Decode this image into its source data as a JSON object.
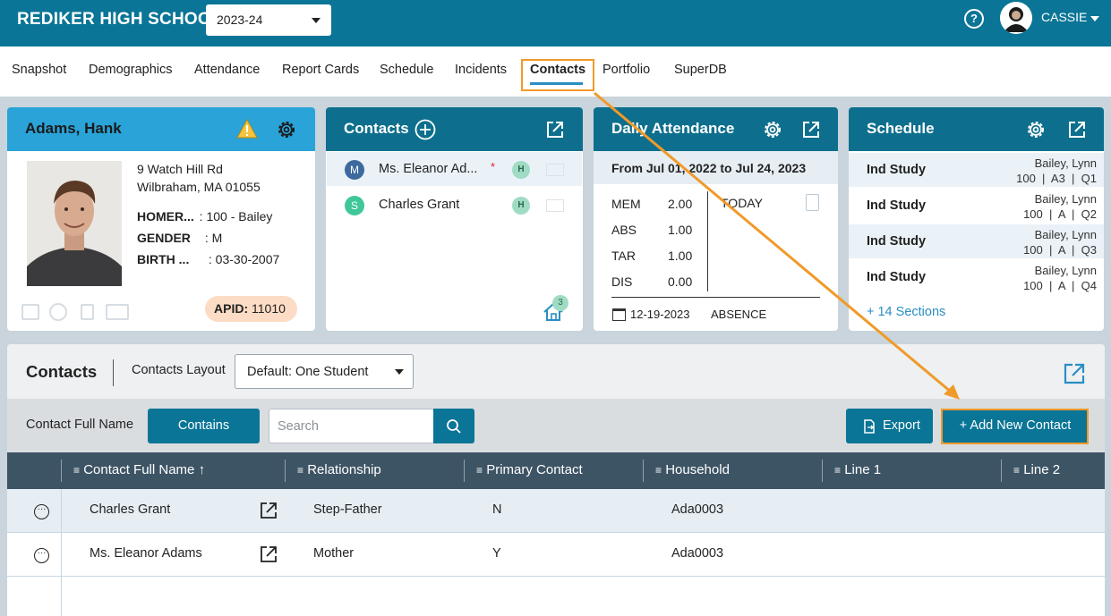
{
  "header": {
    "school_name": "REDIKER HIGH SCHOOL",
    "school_year": "2023-24",
    "user_name": "CASSIE",
    "help_glyph": "?"
  },
  "tabs": [
    {
      "label": "Snapshot"
    },
    {
      "label": "Demographics"
    },
    {
      "label": "Attendance"
    },
    {
      "label": "Report Cards"
    },
    {
      "label": "Schedule"
    },
    {
      "label": "Incidents"
    },
    {
      "label": "Contacts",
      "active": true
    },
    {
      "label": "Portfolio"
    },
    {
      "label": "SuperDB"
    }
  ],
  "student_card": {
    "name": "Adams, Hank",
    "address_line1": "9 Watch Hill Rd",
    "address_line2": "Wilbraham, MA 01055",
    "fields": [
      {
        "label": "HOMER...",
        "value": ": 100 - Bailey"
      },
      {
        "label": "GENDER",
        "value": ": M"
      },
      {
        "label": "BIRTH ...",
        "value": ": 03-30-2007"
      }
    ],
    "apid_label": "APID:",
    "apid_value": "11010"
  },
  "contacts_card": {
    "title": "Contacts",
    "contacts": [
      {
        "initial": "M",
        "name": "Ms. Eleanor Ad...",
        "required_mark": "*",
        "badge": "H",
        "avatar_color": "#3d6a9e"
      },
      {
        "initial": "S",
        "name": "Charles Grant",
        "badge": "H",
        "avatar_color": "#3fc79a"
      }
    ],
    "household_count": "3"
  },
  "attendance_card": {
    "title": "Daily Attendance",
    "range": "From Jul 01, 2022 to Jul 24, 2023",
    "stats": [
      {
        "label": "MEM",
        "value": "2.00"
      },
      {
        "label": "ABS",
        "value": "1.00"
      },
      {
        "label": "TAR",
        "value": "1.00"
      },
      {
        "label": "DIS",
        "value": "0.00"
      }
    ],
    "today_label": "TODAY",
    "last_date": "12-19-2023",
    "last_status": "ABSENCE"
  },
  "schedule_card": {
    "title": "Schedule",
    "rows": [
      {
        "course": "Ind Study",
        "teacher": "Bailey, Lynn",
        "detail": "100  |  A3  |  Q1"
      },
      {
        "course": "Ind Study",
        "teacher": "Bailey, Lynn",
        "detail": "100  |  A  |  Q2"
      },
      {
        "course": "Ind Study",
        "teacher": "Bailey, Lynn",
        "detail": "100  |  A  |  Q3"
      },
      {
        "course": "Ind Study",
        "teacher": "Bailey, Lynn",
        "detail": "100  |  A  |  Q4"
      }
    ],
    "more_link": "+ 14 Sections"
  },
  "contacts_panel": {
    "title": "Contacts",
    "layout_label": "Contacts Layout",
    "layout_value": "Default: One Student",
    "filter_field": "Contact Full Name",
    "filter_op": "Contains",
    "search_placeholder": "Search",
    "export_label": "Export",
    "add_label": "+ Add New Contact",
    "columns": [
      "Contact Full Name ↑",
      "Relationship",
      "Primary Contact",
      "Household",
      "Line 1",
      "Line 2"
    ],
    "rows": [
      {
        "name": "Charles Grant",
        "relationship": "Step-Father",
        "primary": "N",
        "household": "Ada0003"
      },
      {
        "name": "Ms. Eleanor Adams",
        "relationship": "Mother",
        "primary": "Y",
        "household": "Ada0003"
      }
    ]
  },
  "colors": {
    "brand": "#0a7596",
    "highlight": "#f09a2a"
  }
}
